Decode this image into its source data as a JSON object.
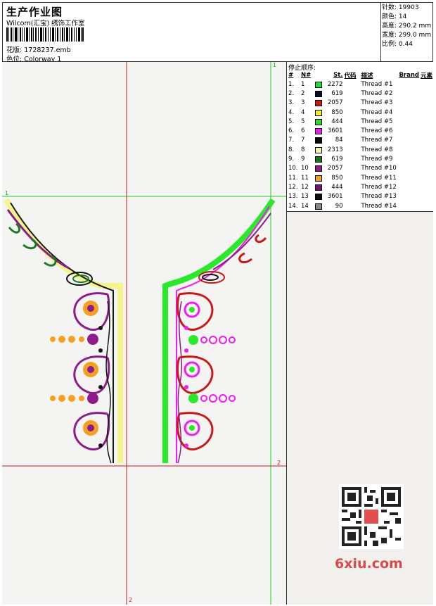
{
  "header": {
    "title": "生产作业图",
    "company": "Wilcom(汇宝) 绣饰工作室",
    "design_label": "花版:",
    "design_value": "1728237.emb",
    "colorway_label": "色位:",
    "colorway_value": "Colorway 1"
  },
  "specs": [
    {
      "label": "针数:",
      "value": "19903"
    },
    {
      "label": "颜色:",
      "value": "14"
    },
    {
      "label": "高度:",
      "value": "290.2 mm"
    },
    {
      "label": "宽度:",
      "value": "299.0 mm"
    },
    {
      "label": "比例:",
      "value": "0.44"
    }
  ],
  "markers": {
    "green_1": "1",
    "red_2": "2"
  },
  "thread_table": {
    "title": "停止顺序:",
    "columns": [
      "#",
      "N#",
      "St.",
      "代码",
      "描述",
      "Brand",
      "元素"
    ],
    "rows": [
      {
        "num": "1.",
        "n": "1",
        "color": "#22e02a",
        "st": "2272",
        "desc": "Thread #1"
      },
      {
        "num": "2.",
        "n": "2",
        "color": "#0a0a2a",
        "st": "619",
        "desc": "Thread #2"
      },
      {
        "num": "3.",
        "n": "3",
        "color": "#d41414",
        "st": "2057",
        "desc": "Thread #3"
      },
      {
        "num": "4.",
        "n": "4",
        "color": "#f2f214",
        "st": "850",
        "desc": "Thread #4"
      },
      {
        "num": "5.",
        "n": "5",
        "color": "#22e02a",
        "st": "444",
        "desc": "Thread #5"
      },
      {
        "num": "6.",
        "n": "6",
        "color": "#f01cf0",
        "st": "3601",
        "desc": "Thread #6"
      },
      {
        "num": "7.",
        "n": "7",
        "color": "#0a0a0a",
        "st": "84",
        "desc": "Thread #7"
      },
      {
        "num": "8.",
        "n": "8",
        "color": "#f8f8a0",
        "st": "2313",
        "desc": "Thread #8"
      },
      {
        "num": "9.",
        "n": "9",
        "color": "#0f7a1a",
        "st": "619",
        "desc": "Thread #9"
      },
      {
        "num": "10.",
        "n": "10",
        "color": "#8c1c8c",
        "st": "2057",
        "desc": "Thread #10"
      },
      {
        "num": "11.",
        "n": "11",
        "color": "#f5a020",
        "st": "850",
        "desc": "Thread #11"
      },
      {
        "num": "12.",
        "n": "12",
        "color": "#7a0f7a",
        "st": "444",
        "desc": "Thread #12"
      },
      {
        "num": "13.",
        "n": "13",
        "color": "#101010",
        "st": "3601",
        "desc": "Thread #13"
      },
      {
        "num": "14.",
        "n": "14",
        "color": "#8a8a8a",
        "st": "90",
        "desc": "Thread #14"
      }
    ]
  },
  "watermark": "6xiu.com"
}
